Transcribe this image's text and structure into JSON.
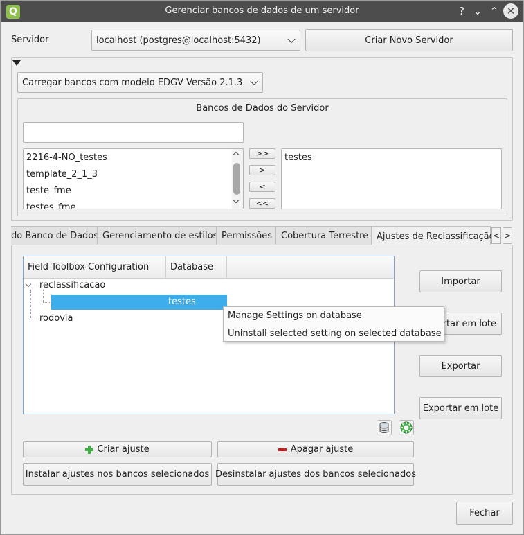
{
  "window": {
    "title": "Gerenciar bancos de dados de um servidor",
    "app_icon": "Q",
    "controls": {
      "help": "?",
      "minimize": "⌄",
      "maximize": "⌃",
      "close": "✕"
    }
  },
  "server": {
    "label": "Servidor",
    "selected": "localhost (postgres@localhost:5432)",
    "create_button": "Criar Novo Servidor"
  },
  "load_combo": "Carregar bancos com modelo EDGV Versão 2.1.3",
  "server_dbs": {
    "title": "Bancos de Dados do Servidor",
    "filter_value": "",
    "available": [
      "2216-4-NO_testes",
      "template_2_1_3",
      "teste_fme",
      "testes_fme"
    ],
    "selected": [
      "testes"
    ],
    "move_buttons": {
      "all_right": ">>",
      "right": ">",
      "left": "<",
      "all_left": "<<"
    }
  },
  "tabs": [
    "do Banco de Dados",
    "Gerenciamento de estilos",
    "Permissões",
    "Cobertura Terrestre",
    "Ajustes de Reclassificação"
  ],
  "tab_arrows": {
    "left": "<",
    "right": ">"
  },
  "tree": {
    "headers": [
      "Field Toolbox Configuration",
      "Database"
    ],
    "nodes": {
      "root1": "reclassificacao",
      "child_db": "testes",
      "root2": "rodovia"
    }
  },
  "side_buttons": {
    "import": "Importar",
    "import_batch": "Importar em lote",
    "import_batch_visible": "ortar em lote",
    "export": "Exportar",
    "export_batch": "Exportar em lote"
  },
  "context_menu": [
    "Manage Settings on database",
    "Uninstall selected setting on selected database"
  ],
  "bottom": {
    "create": "Criar ajuste",
    "delete": "Apagar ajuste",
    "install": "Instalar ajustes nos bancos selecionados",
    "uninstall": "Desinstalar ajustes dos bancos selecionados",
    "close": "Fechar"
  },
  "icons": {
    "collapse": "triangle-down-icon",
    "database": "database-icon",
    "settings": "gear-icon",
    "create": "plus-icon",
    "delete": "minus-icon"
  },
  "colors": {
    "titlebar": "#4d4d4d",
    "selection": "#3daee9",
    "plus": "#3cb043",
    "minus": "#d01e1e"
  }
}
